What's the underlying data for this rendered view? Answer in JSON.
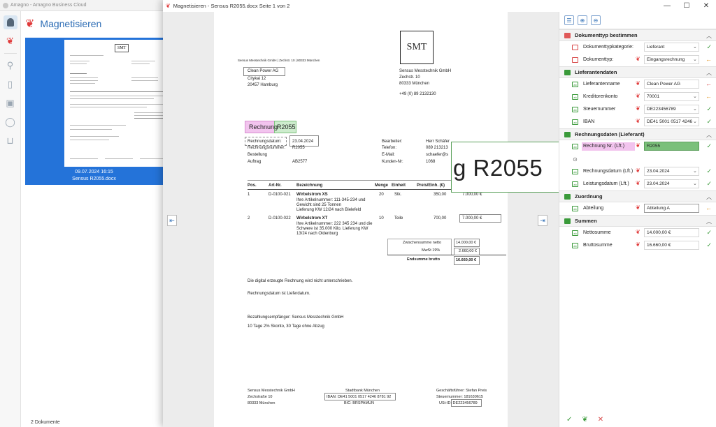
{
  "bg_app": {
    "title": "Amagno - Amagno Business Cloud",
    "header_title": "Magnetisieren",
    "card_date": "09.07.2024 16:15",
    "card_name": "Sensus R2055.docx",
    "footer_count": "2 Dokumente",
    "thumb_logo": "SMT"
  },
  "window": {
    "title": "Magnetisieren - Sensus R2055.docx Seite 1 von 2",
    "minimize": "—",
    "maximize": "☐",
    "close": "✕"
  },
  "doc": {
    "logo": "SMT",
    "sender_line": "Sensus Messtechnik GmbH | Zechstr. 10 | 80333 München",
    "recipient": [
      "Clean Power AG",
      "Citykai 12",
      "20457 Hamburg"
    ],
    "sender": [
      "Sensus Messtechnik GmbH",
      "Zechstr. 10",
      "80333 München",
      "+49 (0) 89 2132130"
    ],
    "title_word": "Rechnung",
    "title_num": "R2055",
    "meta_labels": [
      "Rechnungsdatum:",
      "Rechnungsnummer:",
      "Bestellung",
      "Auftrag"
    ],
    "meta_values": [
      "23.04.2024",
      "R2055",
      "",
      "AB2577"
    ],
    "contact_labels": [
      "Bearbeiter:",
      "Telefon:",
      "E-Mail:",
      "Kunden-Nr:"
    ],
    "contact_values": [
      "Herr Schäfer",
      "089 213213",
      "schaefer@s",
      "1068"
    ],
    "zoom_text": "g R2055",
    "table_headers": [
      "Pos.",
      "Art-Nr.",
      "Bezeichnung",
      "Menge",
      "Einheit",
      "Preis/Einh. (€)",
      "Preis (€)"
    ],
    "items": [
      {
        "pos": "1",
        "art": "D-0100-021",
        "name": "Wirbelstrom XS",
        "desc": [
          "Ihre Artikelnummer: 111-345-234 und",
          "Gewicht sind 25 Tonnen",
          "Lieferung KW 12/24 nach Bielefeld"
        ],
        "qty": "20",
        "unit": "Stk.",
        "price": "350,00",
        "total": "7.000,00 €"
      },
      {
        "pos": "2",
        "art": "D-0100-022",
        "name": "Wirbelstrom XT",
        "desc": [
          "Ihre Artikelnummer: 222 345 234 und die",
          "Schwere ist 35.000 Kilo. Lieferung KW",
          "13/24 nach Oldenburg"
        ],
        "qty": "10",
        "unit": "Teile",
        "price": "700,00",
        "total": "7.000,00 €"
      }
    ],
    "totals": [
      {
        "label": "Zwischensumme netto",
        "value": "14.000,00 €"
      },
      {
        "label": "MwSt 19%",
        "value": "2.660,00 €"
      },
      {
        "label": "Endsumme brutto",
        "value": "16.660,00 €"
      }
    ],
    "notes": [
      "Die digital erzeugte Rechnung wird nicht unterschrieben.",
      "Rechnungsdatum ist Lieferdatum.",
      "Bezahlungsempfänger: Sensus Messtechnik GmbH",
      "10 Tage 2% Skonto, 30 Tage ohne Abzug"
    ],
    "footer_col1": [
      "Sensus Messtechnik GmbH",
      "Zechstraße 10",
      "80333 München"
    ],
    "footer_col2": [
      "Stadtbank München",
      "IBAN: DE41 5001 0517 4246 8781 92",
      "BIC: BRSPAMUN"
    ],
    "footer_col3": [
      "Geschäftsführer: Stefan Preis",
      "Steuernummer: 181630615",
      "USt-ID: DE223456789"
    ]
  },
  "panel": {
    "sections": [
      {
        "title": "Dokumenttyp bestimmen",
        "color": "#e05a5a",
        "fields": [
          {
            "label": "Dokumenttypkategorie:",
            "value": "Lieferant",
            "status": "ok",
            "dropdown": true,
            "magnet": false
          },
          {
            "label": "Dokumenttyp:",
            "value": "Eingangsrechnung",
            "status": "warn",
            "dropdown": true,
            "magnet": true
          }
        ]
      },
      {
        "title": "Lieferantendaten",
        "color": "#3a9a3a",
        "fields": [
          {
            "label": "Lieferantenname",
            "value": "Clean Power AG",
            "status": "err",
            "dropdown": false,
            "magnet": true
          },
          {
            "label": "Kreditorenkonto",
            "value": "70001",
            "status": "warn",
            "dropdown": true,
            "magnet": true
          },
          {
            "label": "Steuernummer",
            "value": "DE223456789",
            "status": "ok",
            "dropdown": true,
            "magnet": true
          },
          {
            "label": "IBAN",
            "value": "DE41 5001 0517 4246",
            "status": "ok",
            "dropdown": true,
            "magnet": true
          }
        ]
      },
      {
        "title": "Rechnungsdaten (Lieferant)",
        "color": "#3a9a3a",
        "fields": [
          {
            "label": "Rechnung Nr. (Lft.)",
            "value": "R2055",
            "status": "ok",
            "dropdown": false,
            "magnet": true,
            "active": true
          },
          {
            "label": "",
            "value": "",
            "status": "",
            "dropdown": false,
            "magnet": false,
            "pin": true
          },
          {
            "label": "Rechnungsdatum (Lft.)",
            "value": "23.04.2024",
            "status": "ok",
            "dropdown": true,
            "magnet": true
          },
          {
            "label": "Leistungsdatum (Lft.)",
            "value": "23.04.2024",
            "status": "ok",
            "dropdown": true,
            "magnet": true
          }
        ]
      },
      {
        "title": "Zuordnung",
        "color": "#3a9a3a",
        "fields": [
          {
            "label": "Abteilung",
            "value": "Abteilung A",
            "status": "warn",
            "dropdown": false,
            "magnet": true,
            "outlined": true
          }
        ]
      },
      {
        "title": "Summen",
        "color": "#3a9a3a",
        "fields": [
          {
            "label": "Nettosumme",
            "value": "14.000,00 €",
            "status": "ok",
            "dropdown": false,
            "magnet": true
          },
          {
            "label": "Bruttosumme",
            "value": "16.660,00 €",
            "status": "ok",
            "dropdown": false,
            "magnet": true
          }
        ]
      }
    ]
  },
  "colors": {
    "accent": "#2473d9",
    "ok": "#3a9a3a",
    "warn": "#e39520",
    "err": "#d84848",
    "active_field": "#7ac07a",
    "highlight": "#f2c4ee"
  }
}
